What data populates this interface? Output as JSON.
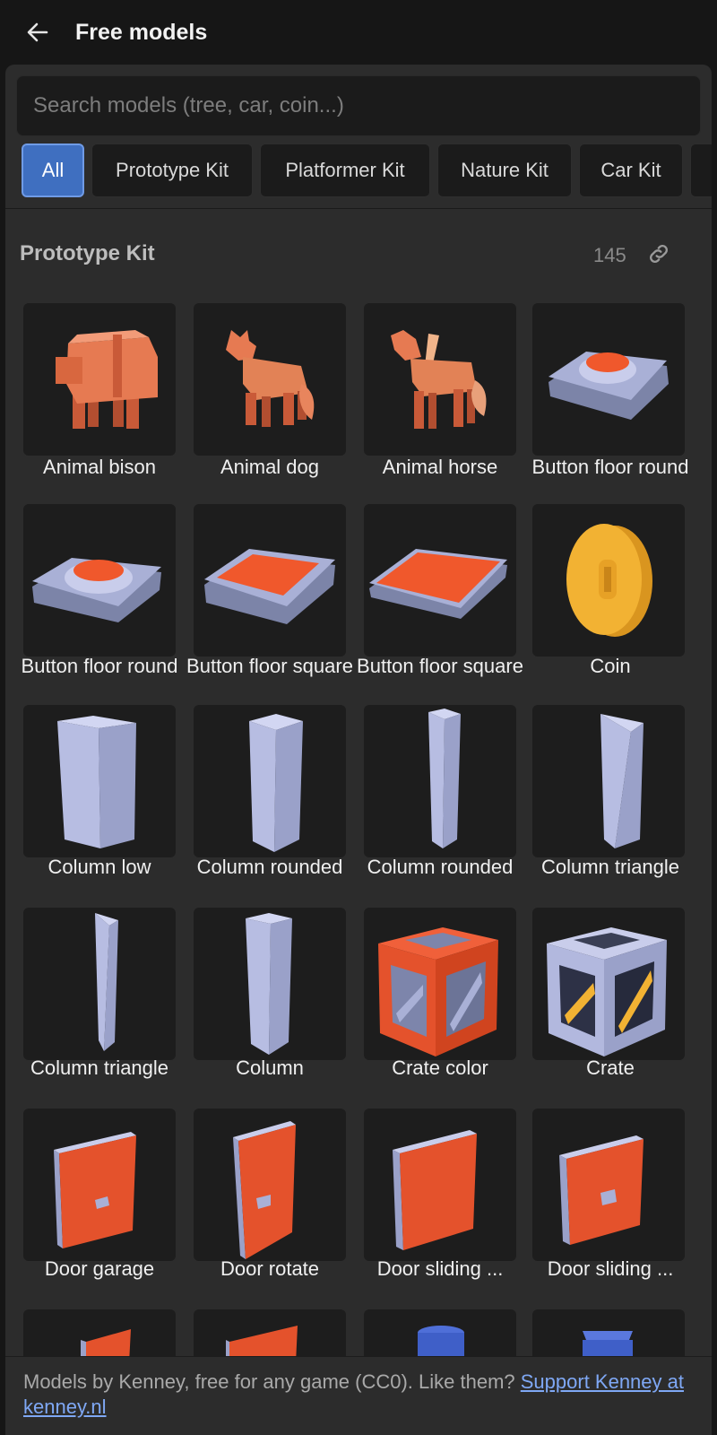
{
  "header": {
    "title": "Free models",
    "back_icon": "arrow-left-icon"
  },
  "search": {
    "placeholder": "Search models (tree, car, coin...)",
    "value": ""
  },
  "filters": [
    "All",
    "Prototype Kit",
    "Platformer Kit",
    "Nature Kit",
    "Car Kit"
  ],
  "active_filter": "All",
  "section": {
    "title": "Prototype Kit",
    "count": "145",
    "link_icon": "link-icon"
  },
  "models": [
    {
      "label": "Animal bison"
    },
    {
      "label": "Animal dog"
    },
    {
      "label": "Animal horse"
    },
    {
      "label": "Button floor round"
    },
    {
      "label": "Button floor round"
    },
    {
      "label": "Button floor square"
    },
    {
      "label": "Button floor square"
    },
    {
      "label": "Coin"
    },
    {
      "label": "Column low"
    },
    {
      "label": "Column rounded"
    },
    {
      "label": "Column rounded"
    },
    {
      "label": "Column triangle"
    },
    {
      "label": "Column triangle"
    },
    {
      "label": "Column"
    },
    {
      "label": "Crate color"
    },
    {
      "label": "Crate"
    },
    {
      "label": "Door garage"
    },
    {
      "label": "Door rotate"
    },
    {
      "label": "Door sliding ..."
    },
    {
      "label": "Door sliding ..."
    },
    {
      "label": ""
    },
    {
      "label": ""
    },
    {
      "label": ""
    },
    {
      "label": ""
    }
  ],
  "footer": {
    "text": "Models by Kenney, free for any game (CC0). Like them?",
    "link_text": "Support Kenney at kenney.nl"
  },
  "colors": {
    "accent": "#3f6fc0",
    "model_orange": "#e2643e",
    "model_grey": "#9aa3c9",
    "coin": "#f2b233",
    "link": "#7fa8f5"
  }
}
